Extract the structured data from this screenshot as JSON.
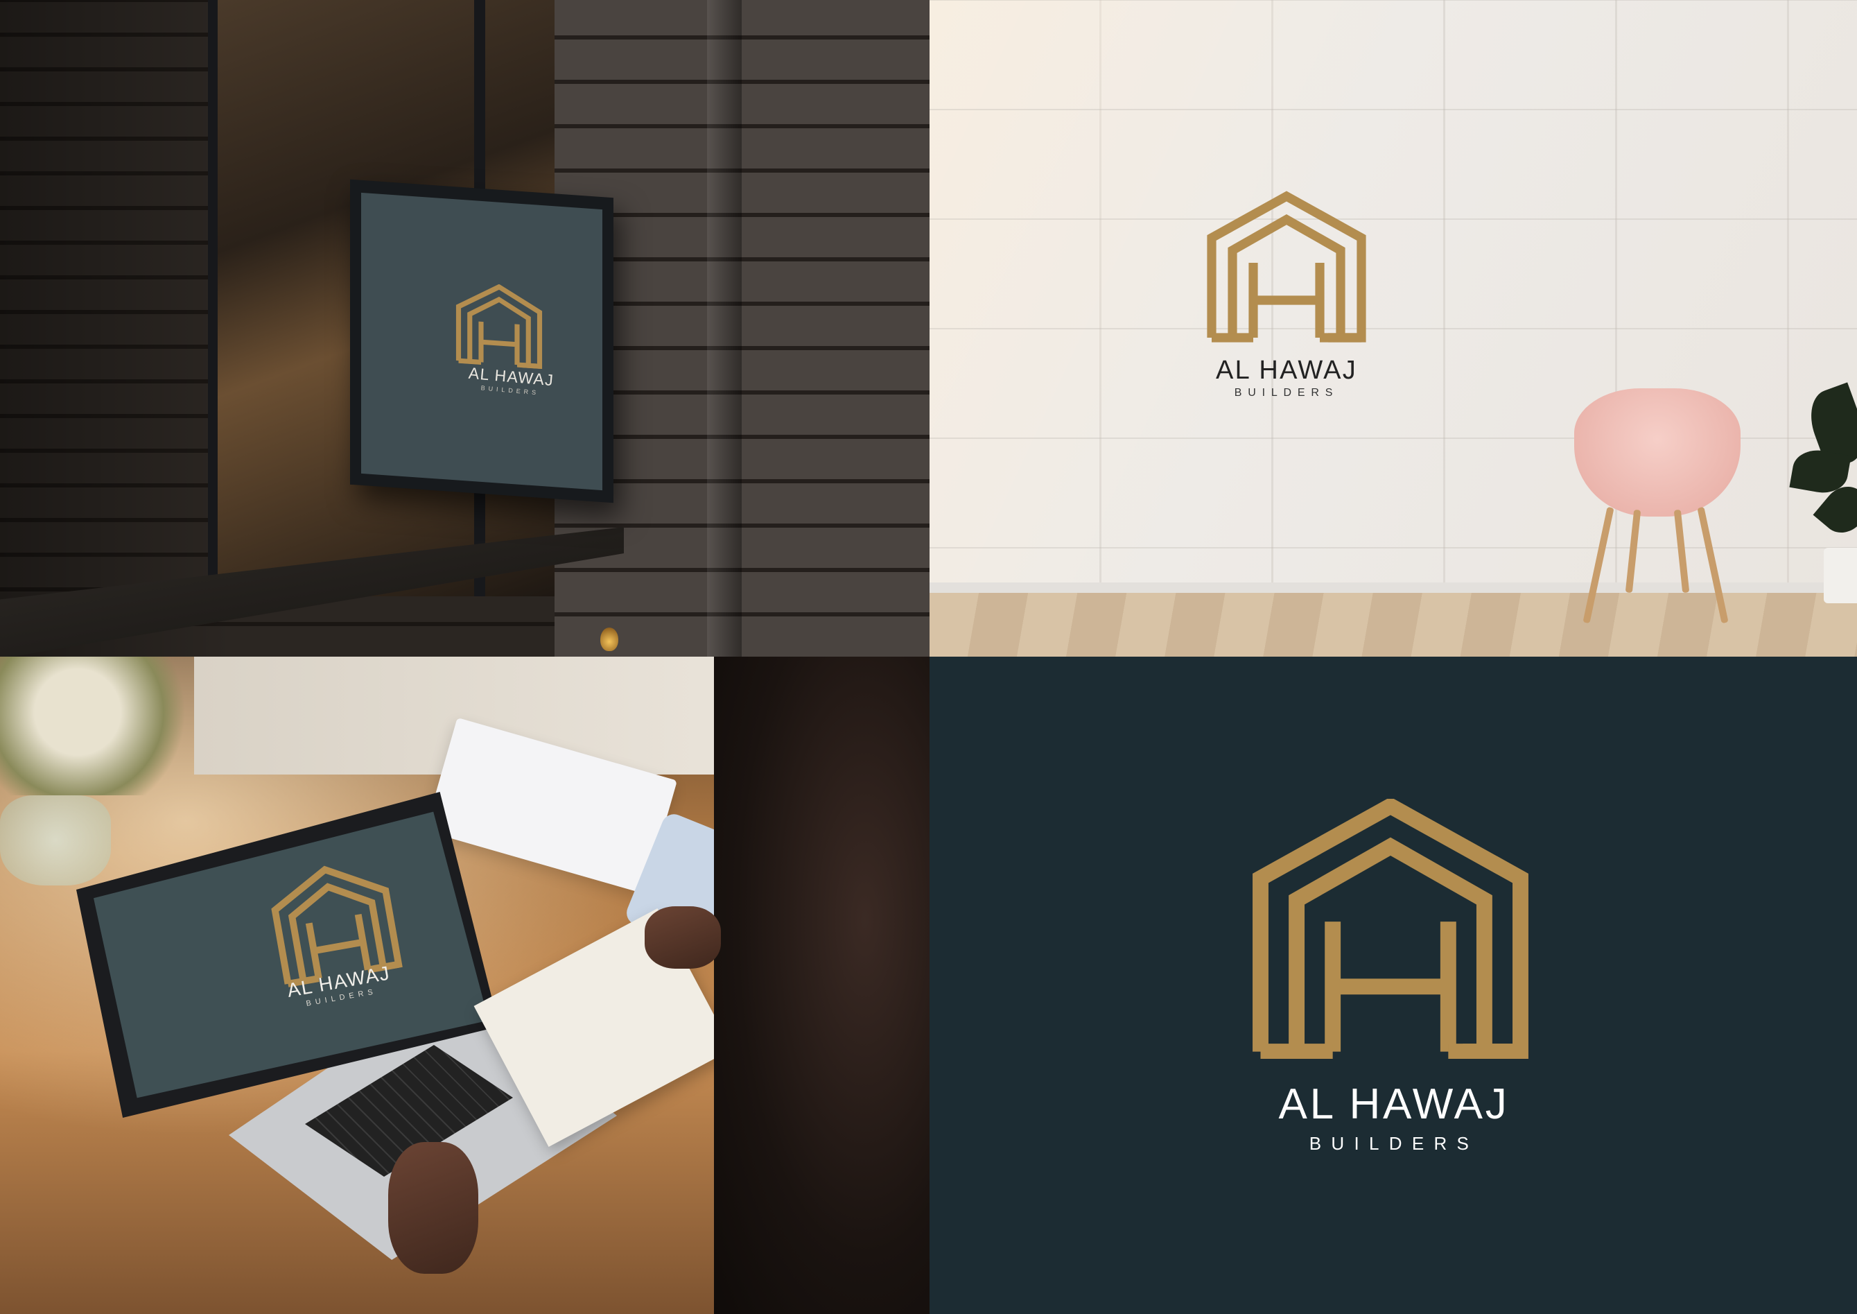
{
  "brand": {
    "name": "AL HAWAJ",
    "tagline": "BUILDERS",
    "gold_color": "#b38d4f",
    "navy_color": "#1c2c33",
    "signboard_color": "#3f4d52",
    "dark_text_color": "#222222",
    "light_text_color": "#ffffff"
  },
  "panels": {
    "signboard": {
      "scene": "brick-wall-lightbox"
    },
    "wall": {
      "scene": "white-wall-pink-chair"
    },
    "laptop": {
      "scene": "desk-laptop-notebook"
    },
    "solid": {
      "scene": "navy-solid-background"
    }
  },
  "icons": {
    "logo": "house-h-monogram-icon",
    "chair": "chair-icon",
    "plant": "plant-icon",
    "bulb": "light-bulb-icon",
    "laptop": "laptop-icon",
    "notebook": "notebook-icon",
    "flowers": "flower-vase-icon"
  }
}
